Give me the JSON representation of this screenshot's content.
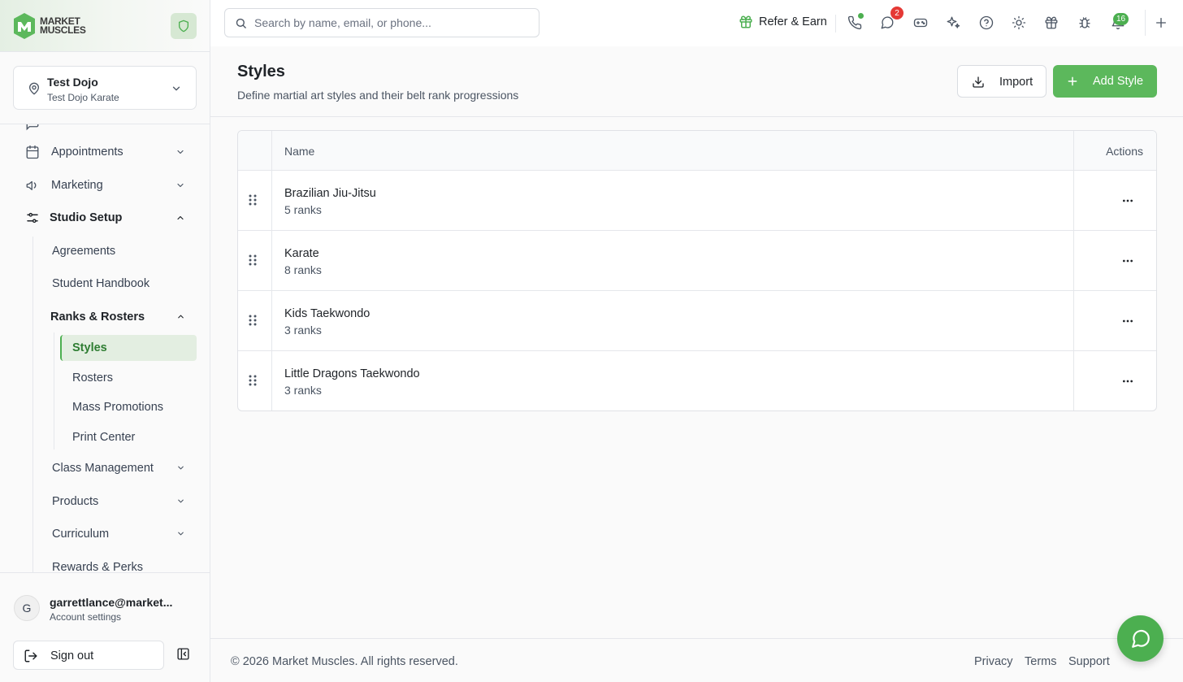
{
  "brand": {
    "line1": "MARKET",
    "line2": "MUSCLES",
    "accent": "#4caf50"
  },
  "location": {
    "name": "Test Dojo",
    "subtitle": "Test Dojo Karate"
  },
  "nav": {
    "appointments": "Appointments",
    "marketing": "Marketing",
    "studio_setup": "Studio Setup",
    "agreements": "Agreements",
    "student_handbook": "Student Handbook",
    "ranks_rosters": "Ranks & Rosters",
    "styles": "Styles",
    "rosters": "Rosters",
    "mass_promotions": "Mass Promotions",
    "print_center": "Print Center",
    "class_management": "Class Management",
    "products": "Products",
    "curriculum": "Curriculum",
    "rewards_perks": "Rewards & Perks"
  },
  "account": {
    "initial": "G",
    "email": "garrettlance@market...",
    "settings": "Account settings",
    "sign_out": "Sign out"
  },
  "topbar": {
    "search_placeholder": "Search by name, email, or phone...",
    "refer_label": "Refer & Earn",
    "messages_badge": "2",
    "notifications_badge": "16"
  },
  "page": {
    "title": "Styles",
    "subtitle": "Define martial art styles and their belt rank progressions",
    "import_label": "Import",
    "add_label": "Add Style"
  },
  "table": {
    "headers": {
      "name": "Name",
      "actions": "Actions"
    },
    "rows": [
      {
        "name": "Brazilian Jiu-Jitsu",
        "ranks": "5 ranks"
      },
      {
        "name": "Karate",
        "ranks": "8 ranks"
      },
      {
        "name": "Kids Taekwondo",
        "ranks": "3 ranks"
      },
      {
        "name": "Little Dragons Taekwondo",
        "ranks": "3 ranks"
      }
    ]
  },
  "footer": {
    "copyright": "© 2026 Market Muscles. All rights reserved.",
    "privacy": "Privacy",
    "terms": "Terms",
    "support": "Support"
  }
}
